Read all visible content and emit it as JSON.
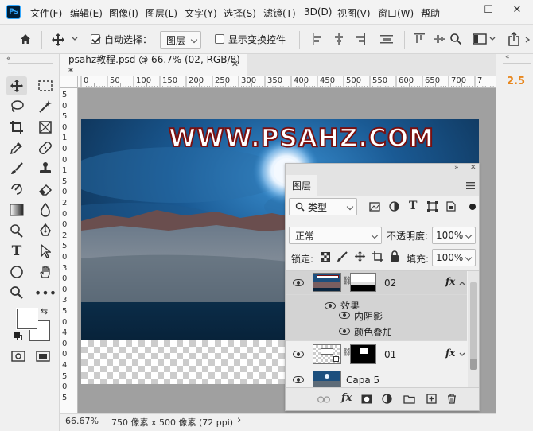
{
  "app": {
    "logo_text": "Ps"
  },
  "menu": [
    "文件(F)",
    "编辑(E)",
    "图像(I)",
    "图层(L)",
    "文字(Y)",
    "选择(S)",
    "滤镜(T)",
    "3D(D)",
    "视图(V)",
    "窗口(W)",
    "帮助"
  ],
  "window_controls": {
    "minimize": "—",
    "maximize": "☐",
    "close": "✕"
  },
  "options": {
    "auto_select_label": "自动选择：",
    "auto_select_checked": true,
    "auto_select_target": "图层",
    "show_transform_label": "显示变换控件",
    "show_transform_checked": false
  },
  "document": {
    "tab_title": "psahz教程.psd @ 66.7% (02, RGB/8) *",
    "tab_close": "✕",
    "watermark": "WWW.PSAHZ.COM"
  },
  "ruler": {
    "h_ticks": [
      "0",
      "50",
      "100",
      "150",
      "200",
      "250",
      "300",
      "350",
      "400",
      "450",
      "500",
      "550",
      "600",
      "650",
      "700",
      "7"
    ],
    "v_ticks": [
      "5",
      "0",
      "5",
      "0",
      "1",
      "0",
      "0",
      "1",
      "5",
      "0",
      "2",
      "0",
      "0",
      "2",
      "5",
      "0",
      "3",
      "0",
      "0",
      "3",
      "5",
      "0",
      "4",
      "0",
      "0",
      "4",
      "5",
      "0",
      "5"
    ]
  },
  "status": {
    "zoom": "66.67%",
    "doc_info": "750 像素 x 500 像素 (72 ppi)",
    "arrow": "›"
  },
  "right_panel": {
    "value": "2.5"
  },
  "layers_panel": {
    "title": "图层",
    "filter_kind": "类型",
    "blend_mode": "正常",
    "opacity_label": "不透明度:",
    "opacity_value": "100%",
    "lock_label": "锁定:",
    "fill_label": "填充:",
    "fill_value": "100%",
    "layers": [
      {
        "name": "02",
        "fx": "fx",
        "selected": true,
        "effects_label": "效果",
        "effects": [
          "内阴影",
          "颜色叠加"
        ]
      },
      {
        "name": "01",
        "fx": "fx",
        "selected": false
      },
      {
        "name": "Capa 5",
        "selected": false
      }
    ],
    "bottom_fx": "fx"
  },
  "colors": {
    "accent_orange": "#e8871e",
    "selection": "#d3d3d3",
    "watermark_stroke": "#7a1010"
  }
}
